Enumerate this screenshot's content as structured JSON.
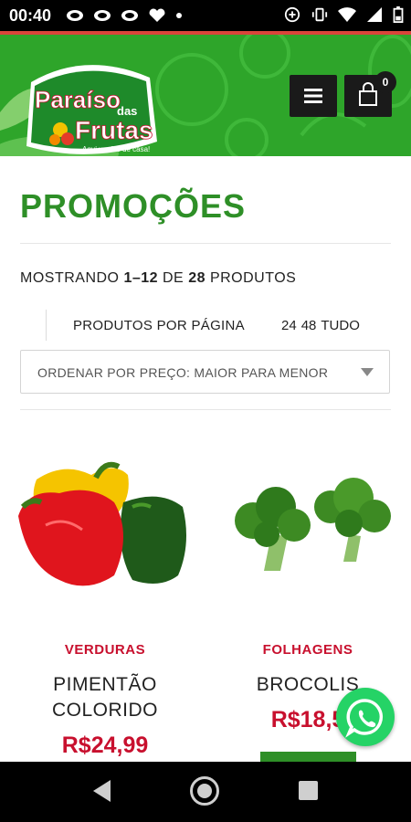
{
  "status_bar": {
    "time": "00:40",
    "left_icons": [
      "eye-icon",
      "eye-icon",
      "eye-icon",
      "heart-icon",
      "dot-icon"
    ],
    "right_icons": [
      "data-saver-icon",
      "vibrate-icon",
      "wifi-icon",
      "signal-icon",
      "battery-icon"
    ]
  },
  "header": {
    "logo": {
      "line1": "Paraíso",
      "line2": "das",
      "line3": "Frutas",
      "tagline": "Aqui você é de casa!"
    },
    "cart_count": "0",
    "brand_color": "#2ea52a"
  },
  "page": {
    "title": "PROMOÇÕES",
    "showing_prefix": "MOSTRANDO",
    "showing_range": "1–12",
    "showing_of": "DE",
    "showing_total": "28",
    "showing_suffix": "PRODUTOS",
    "per_page_label": "PRODUTOS POR PÁGINA",
    "per_page_options": [
      "24",
      "48",
      "TUDO"
    ],
    "sort_selected": "ORDENAR POR PREÇO: MAIOR PARA MENOR"
  },
  "products": [
    {
      "category": "VERDURAS",
      "name": "PIMENTÃO COLORIDO",
      "price": "R$24,99",
      "image": "bell-peppers"
    },
    {
      "category": "FOLHAGENS",
      "name": "BROCOLIS",
      "price": "R$18,5",
      "image": "broccoli"
    }
  ],
  "colors": {
    "accent": "#2e8f27",
    "price": "#c8102e",
    "whatsapp": "#25d366"
  }
}
